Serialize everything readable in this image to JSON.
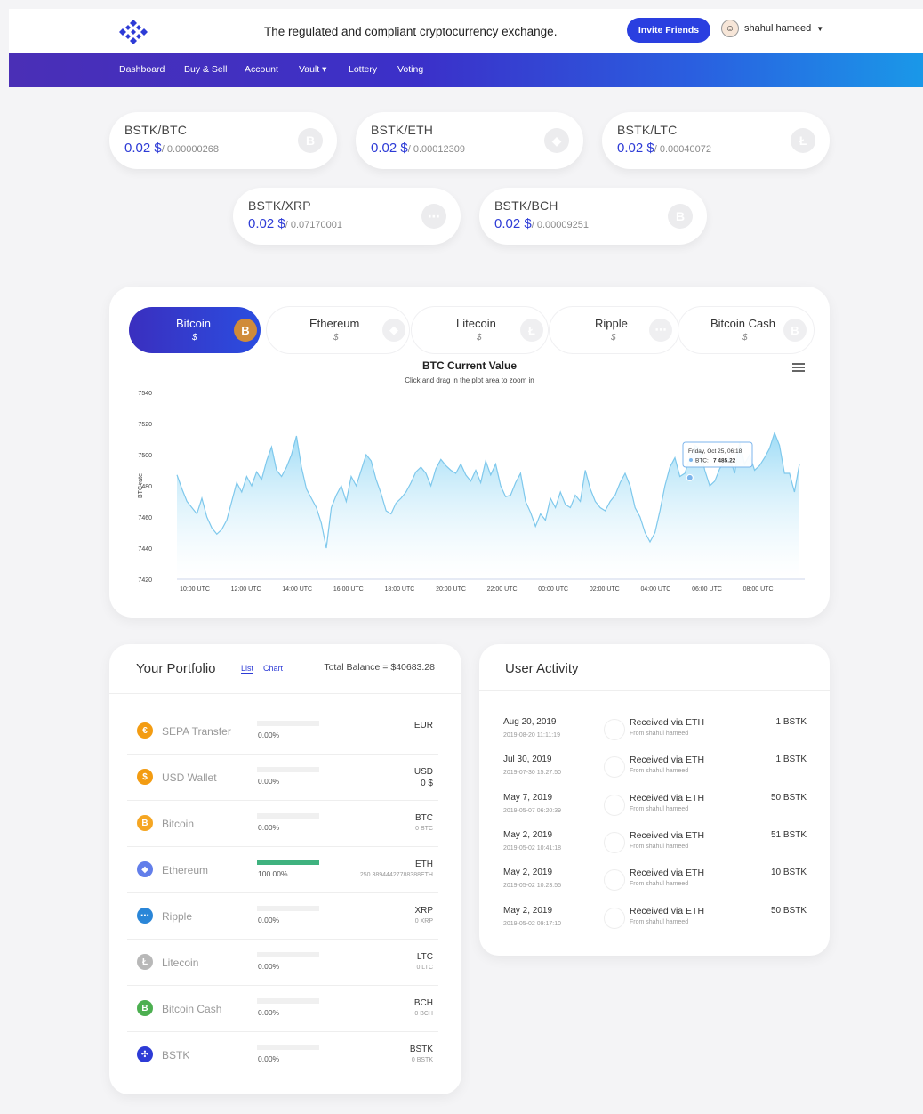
{
  "header": {
    "tagline": "The regulated and compliant cryptocurrency exchange.",
    "invite_label": "Invite Friends",
    "user_name": "shahul hameed"
  },
  "nav": {
    "items": [
      {
        "label": "Dashboard"
      },
      {
        "label": "Buy & Sell"
      },
      {
        "label": "Account"
      },
      {
        "label": "Vault ▾"
      },
      {
        "label": "Lottery"
      },
      {
        "label": "Voting"
      }
    ]
  },
  "tickers": [
    {
      "pair": "BSTK/BTC",
      "price": "0.02 $",
      "rate": "/ 0.00000268",
      "icon": "bitcoin-icon",
      "glyph": "B"
    },
    {
      "pair": "BSTK/ETH",
      "price": "0.02 $",
      "rate": "/ 0.00012309",
      "icon": "ethereum-icon",
      "glyph": "◆"
    },
    {
      "pair": "BSTK/LTC",
      "price": "0.02 $",
      "rate": "/ 0.00040072",
      "icon": "litecoin-icon",
      "glyph": "Ł"
    },
    {
      "pair": "BSTK/XRP",
      "price": "0.02 $",
      "rate": "/ 0.07170001",
      "icon": "ripple-icon",
      "glyph": "⋯"
    },
    {
      "pair": "BSTK/BCH",
      "price": "0.02 $",
      "rate": "/ 0.00009251",
      "icon": "bitcoin-cash-icon",
      "glyph": "B"
    }
  ],
  "chart_tabs": [
    {
      "name": "Bitcoin",
      "currency": "$",
      "active": true,
      "glyph": "B"
    },
    {
      "name": "Ethereum",
      "currency": "$",
      "active": false,
      "glyph": "◆"
    },
    {
      "name": "Litecoin",
      "currency": "$",
      "active": false,
      "glyph": "Ł"
    },
    {
      "name": "Ripple",
      "currency": "$",
      "active": false,
      "glyph": "⋯"
    },
    {
      "name": "Bitcoin Cash",
      "currency": "$",
      "active": false,
      "glyph": "B"
    }
  ],
  "chart_data": {
    "type": "area",
    "title": "BTC Current Value",
    "subtitle": "Click and drag in the plot area to zoom in",
    "ylabel": "BTC rate",
    "xlabel": "",
    "ylim": [
      7420,
      7540
    ],
    "yticks": [
      7420,
      7440,
      7460,
      7480,
      7500,
      7520,
      7540
    ],
    "xticks": [
      "10:00 UTC",
      "12:00 UTC",
      "14:00 UTC",
      "16:00 UTC",
      "18:00 UTC",
      "20:00 UTC",
      "22:00 UTC",
      "00:00 UTC",
      "02:00 UTC",
      "04:00 UTC",
      "06:00 UTC",
      "08:00 UTC"
    ],
    "grid": false,
    "series": [
      {
        "values": [
          7487,
          7478,
          7470,
          7466,
          7462,
          7472,
          7460,
          7453,
          7449,
          7452,
          7458,
          7470,
          7482,
          7476,
          7486,
          7480,
          7489,
          7484,
          7496,
          7505,
          7490,
          7486,
          7492,
          7500,
          7512,
          7492,
          7478,
          7472,
          7466,
          7456,
          7440,
          7466,
          7474,
          7480,
          7470,
          7486,
          7480,
          7490,
          7500,
          7496,
          7484,
          7475,
          7464,
          7462,
          7469,
          7472,
          7476,
          7482,
          7489,
          7492,
          7488,
          7480,
          7491,
          7497,
          7493,
          7490,
          7488,
          7494,
          7487,
          7483,
          7490,
          7482,
          7496,
          7487,
          7494,
          7480,
          7473,
          7474,
          7482,
          7488,
          7470,
          7463,
          7454,
          7462,
          7458,
          7472,
          7466,
          7476,
          7468,
          7466,
          7474,
          7470,
          7490,
          7478,
          7470,
          7466,
          7464,
          7470,
          7474,
          7482,
          7488,
          7480,
          7466,
          7460,
          7450,
          7444,
          7450,
          7464,
          7480,
          7492,
          7498,
          7486,
          7488,
          7498,
          7506,
          7504,
          7490,
          7480,
          7483,
          7491,
          7496,
          7498,
          7488,
          7508,
          7494,
          7500,
          7490,
          7493,
          7498,
          7504,
          7514,
          7506,
          7488,
          7488,
          7476,
          7494
        ]
      }
    ],
    "tooltip": {
      "date": "Friday, Oct 25, 06:18",
      "label": "BTC:",
      "value": "7 485.22"
    }
  },
  "portfolio": {
    "title": "Your Portfolio",
    "tabs": [
      "List",
      "Chart"
    ],
    "total_balance": "Total Balance = $40683.28",
    "rows": [
      {
        "name": "SEPA Transfer",
        "icon": "euro-icon",
        "glyph": "€",
        "color": "#f39c12",
        "pct_value": 0,
        "pct": "0.00%",
        "code": "EUR",
        "amount": ""
      },
      {
        "name": "USD Wallet",
        "icon": "usd-icon",
        "glyph": "$",
        "color": "#f39c12",
        "pct_value": 0,
        "pct": "0.00%",
        "code": "USD",
        "amount": "0 $"
      },
      {
        "name": "Bitcoin",
        "icon": "bitcoin-icon",
        "glyph": "B",
        "color": "#f5a623",
        "pct_value": 0,
        "pct": "0.00%",
        "code": "BTC",
        "amount": "0 BTC"
      },
      {
        "name": "Ethereum",
        "icon": "ethereum-icon",
        "glyph": "◆",
        "color": "#627eea",
        "pct_value": 100,
        "pct": "100.00%",
        "code": "ETH",
        "amount": "250.38944427788388ETH"
      },
      {
        "name": "Ripple",
        "icon": "ripple-icon",
        "glyph": "⋯",
        "color": "#2a86d8",
        "pct_value": 0,
        "pct": "0.00%",
        "code": "XRP",
        "amount": "0 XRP"
      },
      {
        "name": "Litecoin",
        "icon": "litecoin-icon",
        "glyph": "Ł",
        "color": "#b8b8b8",
        "pct_value": 0,
        "pct": "0.00%",
        "code": "LTC",
        "amount": "0 LTC"
      },
      {
        "name": "Bitcoin Cash",
        "icon": "bitcoin-cash-icon",
        "glyph": "B",
        "color": "#4caf50",
        "pct_value": 0,
        "pct": "0.00%",
        "code": "BCH",
        "amount": "0 BCH"
      },
      {
        "name": "BSTK",
        "icon": "bstk-icon",
        "glyph": "✣",
        "color": "#2d3bd6",
        "pct_value": 0,
        "pct": "0.00%",
        "code": "BSTK",
        "amount": "0 BSTK"
      }
    ]
  },
  "activity": {
    "title": "User Activity",
    "rows": [
      {
        "date": "Aug 20, 2019",
        "timestamp": "2019-08-20 11:11:19",
        "type": "Received via ETH",
        "from": "From shahul hameed",
        "amount": "1 BSTK"
      },
      {
        "date": "Jul 30, 2019",
        "timestamp": "2019-07-30 15:27:50",
        "type": "Received via ETH",
        "from": "From shahul hameed",
        "amount": "1 BSTK"
      },
      {
        "date": "May 7, 2019",
        "timestamp": "2019-05-07 06:20:39",
        "type": "Received via ETH",
        "from": "From shahul hameed",
        "amount": "50 BSTK"
      },
      {
        "date": "May 2, 2019",
        "timestamp": "2019-05-02 10:41:18",
        "type": "Received via ETH",
        "from": "From shahul hameed",
        "amount": "51 BSTK"
      },
      {
        "date": "May 2, 2019",
        "timestamp": "2019-05-02 10:23:55",
        "type": "Received via ETH",
        "from": "From shahul hameed",
        "amount": "10 BSTK"
      },
      {
        "date": "May 2, 2019",
        "timestamp": "2019-05-02 09:17:10",
        "type": "Received via ETH",
        "from": "From shahul hameed",
        "amount": "50 BSTK"
      }
    ]
  },
  "colors": {
    "accent": "#2d3bd6",
    "nav_start": "#4a2fb6",
    "nav_end": "#1a98e8",
    "chart_line": "#7ec8ec",
    "chart_fill": "#9fdcf6",
    "positive_bar": "#3fb27f"
  }
}
